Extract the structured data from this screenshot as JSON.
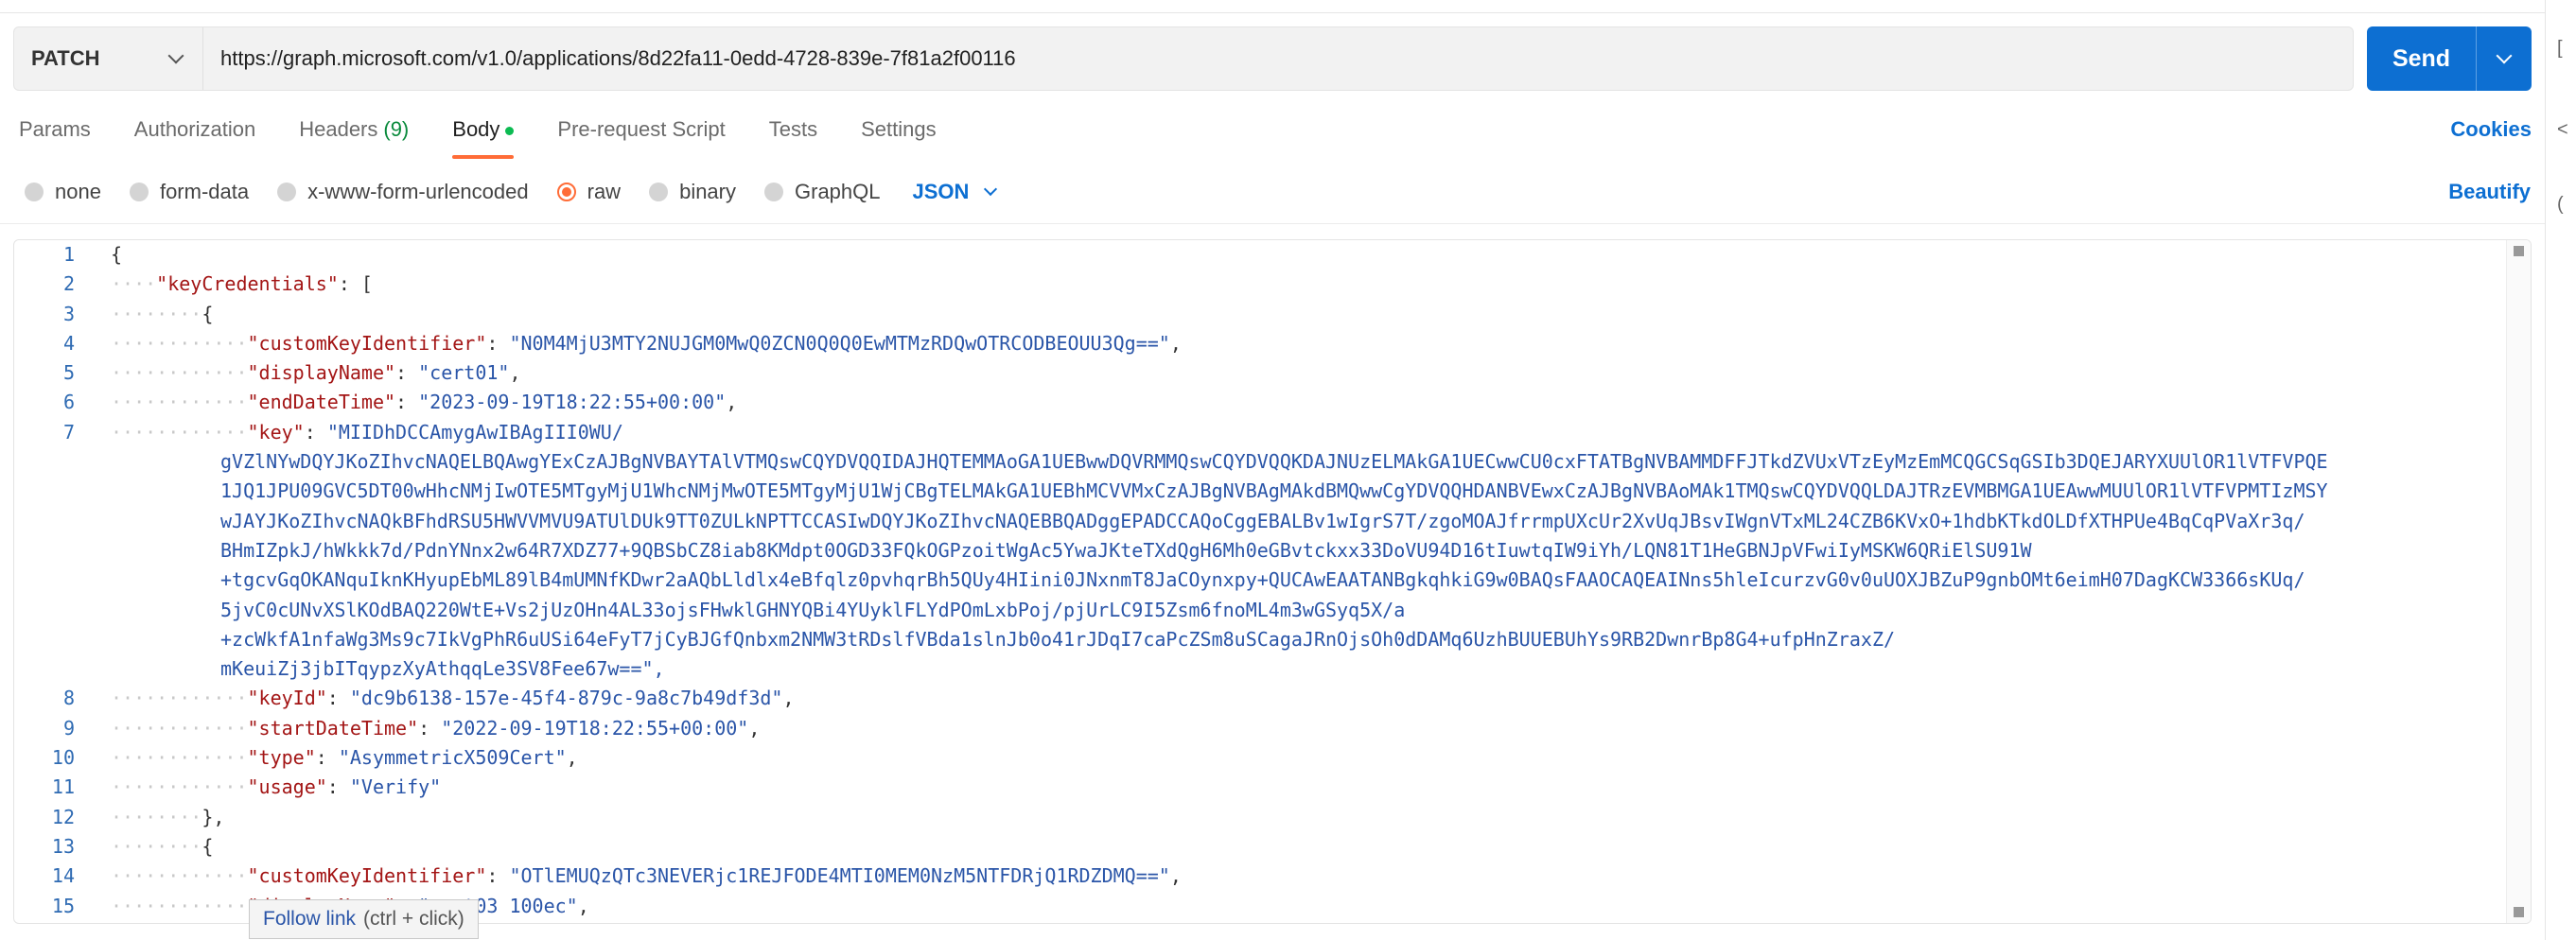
{
  "request": {
    "method": "PATCH",
    "url": "https://graph.microsoft.com/v1.0/applications/8d22fa11-0edd-4728-839e-7f81a2f00116",
    "send_label": "Send"
  },
  "tabs": [
    {
      "label": "Params"
    },
    {
      "label": "Authorization"
    },
    {
      "label": "Headers",
      "count": "(9)"
    },
    {
      "label": "Body"
    },
    {
      "label": "Pre-request Script"
    },
    {
      "label": "Tests"
    },
    {
      "label": "Settings"
    }
  ],
  "cookies_label": "Cookies",
  "body_types": [
    "none",
    "form-data",
    "x-www-form-urlencoded",
    "raw",
    "binary",
    "GraphQL"
  ],
  "language": "JSON",
  "beautify_label": "Beautify",
  "editor": {
    "line_numbers": [
      "1",
      "2",
      "3",
      "4",
      "5",
      "6",
      "7",
      "",
      "",
      "",
      "",
      "",
      "",
      "",
      "",
      "8",
      "9",
      "10",
      "11",
      "12",
      "13",
      "14",
      "15"
    ],
    "lines": [
      "{",
      "    \"keyCredentials\": [",
      "        {",
      "            \"customKeyIdentifier\": \"N0M4MjU3MTY2NUJGM0MwQ0ZCN0Q0Q0EwMTMzRDQwOTRCODBEOUU3Qg==\",",
      "            \"displayName\": \"cert01\",",
      "            \"endDateTime\": \"2023-09-19T18:22:55+00:00\",",
      "            \"key\": \"MIIDhDCCAmygAwIBAgIII0WU/",
      "gVZlNYwDQYJKoZIhvcNAQELBQAwgYExCzAJBgNVBAYTAlVTMQswCQYDVQQIDAJHQTEMMAoGA1UEBwwDQVRMMQswCQYDVQQKDAJNUzELMAkGA1UECwwCU0cxFTATBgNVBAMMDFFJTkdZVUxVTzEyMzEmMCQGCSqGSIb3DQEJARYXUUlOR1lVTFVPQE",
      "1JQ1JPU09GVC5DT00wHhcNMjIwOTE5MTgyMjU1WhcNMjMwOTE5MTgyMjU1WjCBgTELMAkGA1UEBhMCVVMxCzAJBgNVBAgMAkdBMQwwCgYDVQQHDANBVEwxCzAJBgNVBAoMAk1TMQswCQYDVQQLDAJTRzEVMBMGA1UEAwwMUUlOR1lVTFVPMTIzMSY",
      "wJAYJKoZIhvcNAQkBFhdRSU5HWVVMVU9ATUlDUk9TT0ZULkNPTTCCASIwDQYJKoZIhvcNAQEBBQADggEPADCCAQoCggEBALBv1wIgrS7T/zgoMOAJfrrmpUXcUr2XvUqJBsvIWgnVTxML24CZB6KVxO+1hdbKTkdOLDfXTHPUe4BqCqPVaXr3q/",
      "BHmIZpkJ/hWkkk7d/PdnYNnx2w64R7XDZ77+9QBSbCZ8iab8KMdpt0OGD33FQkOGPzoitWgAc5YwaJKteTXdQgH6Mh0eGBvtckxx33DoVU94D16tIuwtqIW9iYh/LQN81T1HeGBNJpVFwiIyMSKW6QRiElSU91W",
      "+tgcvGqOKANquIknKHyupEbML89lB4mUMNfKDwr2aAQbLldlx4eBfqlz0pvhqrBh5QUy4HIini0JNxnmT8JaCOynxpy+QUCAwEAATANBgkqhkiG9w0BAQsFAAOCAQEAINns5hleIcurzvG0v0uUOXJBZuP9gnbOMt6eimH07DagKCW3366sKUq/",
      "5jvC0cUNvXSlKOdBAQ220WtE+Vs2jUzOHn4AL33ojsFHwklGHNYQBi4YUyklFLYdPOmLxbPoj/pjUrLC9I5Zsm6fnoML4m3wGSyq5X/a",
      "+zcWkfA1nfaWg3Ms9c7IkVgPhR6uUSi64eFyT7jCyBJGfQnbxm2NMW3tRDslfVBda1slnJb0o41rJDqI7caPcZSm8uSCagaJRnOjsOh0dDAMq6UzhBUUEBUhYs9RB2DwnrBp8G4+ufpHnZraxZ/",
      "mKeuiZj3jbITqypzXyAthqqLe3SV8Fee67w==\",",
      "            \"keyId\": \"dc9b6138-157e-45f4-879c-9a8c7b49df3d\",",
      "            \"startDateTime\": \"2022-09-19T18:22:55+00:00\",",
      "            \"type\": \"AsymmetricX509Cert\",",
      "            \"usage\": \"Verify\"",
      "        },",
      "        {",
      "            \"customKeyIdentifier\": \"OTlEMUQzQTc3NEVERjc1REJFODE4MTI0MEM0NzM5NTFDRjQ1RDZDMQ==\",",
      "            \"displayName\": \"cert03 100ec\","
    ]
  },
  "tooltip": {
    "label": "Follow link",
    "hint": "(ctrl + click)"
  },
  "right_pane_glyphs": [
    "[",
    "<",
    "("
  ]
}
